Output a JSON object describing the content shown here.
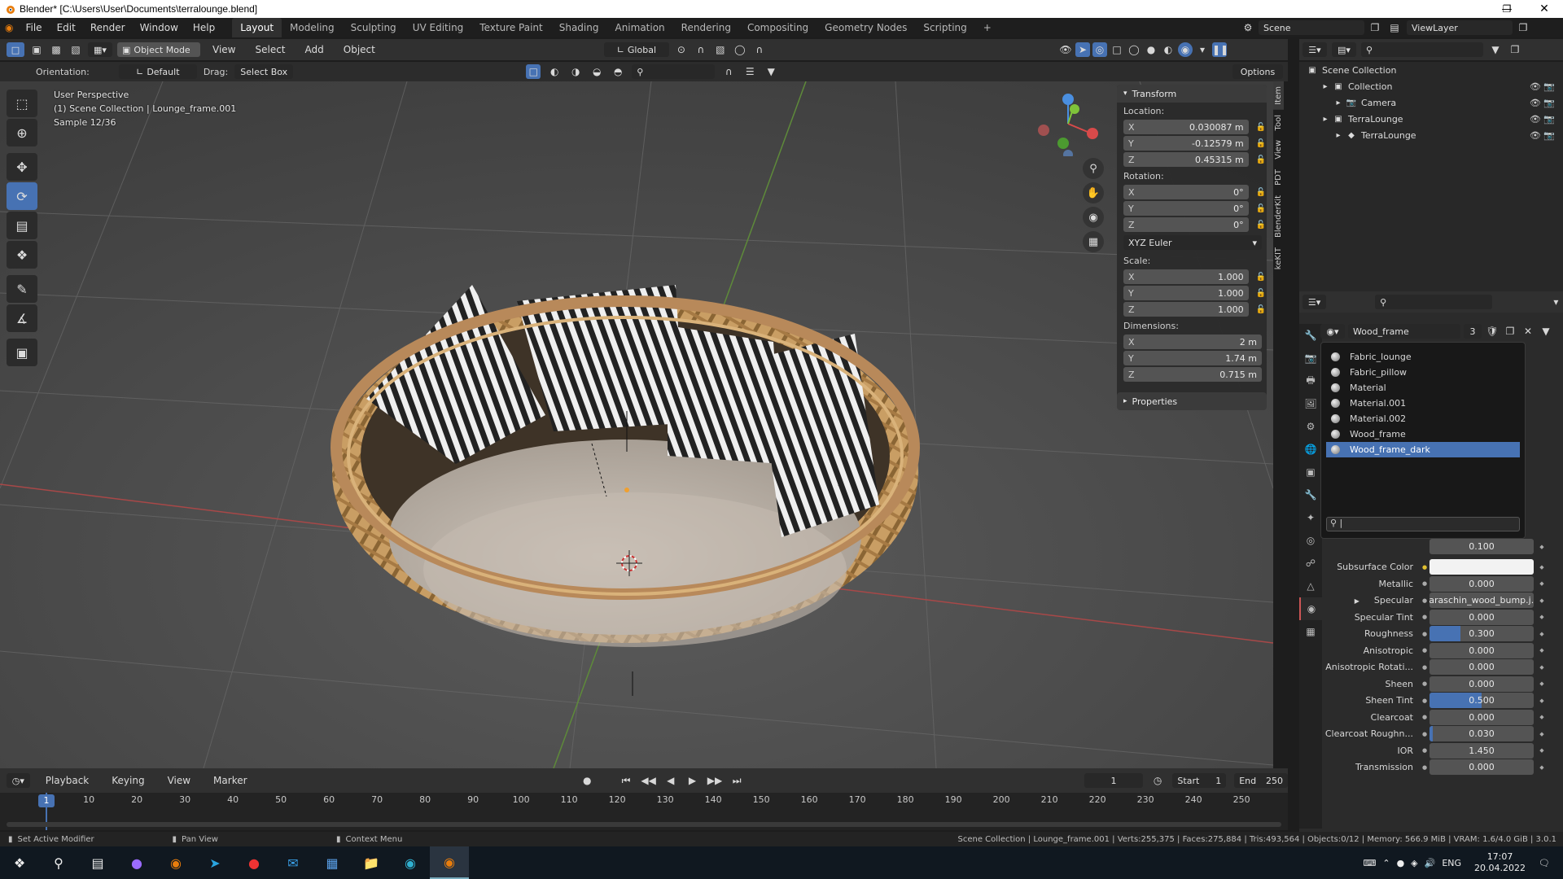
{
  "window": {
    "title": "Blender* [C:\\Users\\User\\Documents\\terralounge.blend]"
  },
  "menu": {
    "items": [
      "File",
      "Edit",
      "Render",
      "Window",
      "Help"
    ]
  },
  "workspaces": [
    "Layout",
    "Modeling",
    "Sculpting",
    "UV Editing",
    "Texture Paint",
    "Shading",
    "Animation",
    "Rendering",
    "Compositing",
    "Geometry Nodes",
    "Scripting"
  ],
  "workspace_add": "+",
  "scene": {
    "name": "Scene",
    "view_layer": "ViewLayer"
  },
  "viewport_header": {
    "mode": "Object Mode",
    "view": "View",
    "select": "Select",
    "add": "Add",
    "object": "Object",
    "transform_orientation": "Global",
    "orientation_label": "Orientation:",
    "orientation_value": "Default",
    "drag_label": "Drag:",
    "drag_value": "Select Box",
    "options": "Options"
  },
  "viewport_info": {
    "line1": "User Perspective",
    "line2": "(1) Scene Collection | Lounge_frame.001",
    "line3": "Sample 12/36"
  },
  "npanel": {
    "transform": "Transform",
    "location_label": "Location:",
    "location": [
      {
        "axis": "X",
        "value": "0.030087 m"
      },
      {
        "axis": "Y",
        "value": "-0.12579 m"
      },
      {
        "axis": "Z",
        "value": "0.45315 m"
      }
    ],
    "rotation_label": "Rotation:",
    "rotation": [
      {
        "axis": "X",
        "value": "0°"
      },
      {
        "axis": "Y",
        "value": "0°"
      },
      {
        "axis": "Z",
        "value": "0°"
      }
    ],
    "rotation_mode": "XYZ Euler",
    "scale_label": "Scale:",
    "scale": [
      {
        "axis": "X",
        "value": "1.000"
      },
      {
        "axis": "Y",
        "value": "1.000"
      },
      {
        "axis": "Z",
        "value": "1.000"
      }
    ],
    "dimensions_label": "Dimensions:",
    "dimensions": [
      {
        "axis": "X",
        "value": "2 m"
      },
      {
        "axis": "Y",
        "value": "1.74 m"
      },
      {
        "axis": "Z",
        "value": "0.715 m"
      }
    ],
    "properties": "Properties",
    "tabs": [
      "Item",
      "Tool",
      "View",
      "PDT",
      "BlenderKit",
      "keKIT"
    ]
  },
  "outliner": {
    "rows": [
      {
        "name": "Scene Collection",
        "depth": 0
      },
      {
        "name": "Collection",
        "depth": 1
      },
      {
        "name": "Camera",
        "depth": 2
      },
      {
        "name": "TerraLounge",
        "depth": 1
      },
      {
        "name": "TerraLounge",
        "depth": 2
      }
    ]
  },
  "material": {
    "name": "Wood_frame",
    "users": "3",
    "list": [
      "Fabric_lounge",
      "Fabric_pillow",
      "Material",
      "Material.001",
      "Material.002",
      "Wood_frame",
      "Wood_frame_dark"
    ],
    "selected": "Wood_frame_dark",
    "partial_value": "0.100",
    "rows": [
      {
        "label": "Subsurface Color",
        "value": "",
        "color": "#f2f2f2"
      },
      {
        "label": "Metallic",
        "value": "0.000",
        "fill": 0
      },
      {
        "label": "Specular",
        "value": "varaschin_wood_bump.j...",
        "expand": true
      },
      {
        "label": "Specular Tint",
        "value": "0.000",
        "fill": 0
      },
      {
        "label": "Roughness",
        "value": "0.300",
        "fill": 0.3
      },
      {
        "label": "Anisotropic",
        "value": "0.000",
        "fill": 0
      },
      {
        "label": "Anisotropic Rotati...",
        "value": "0.000",
        "fill": 0
      },
      {
        "label": "Sheen",
        "value": "0.000",
        "fill": 0
      },
      {
        "label": "Sheen Tint",
        "value": "0.500",
        "fill": 0.5
      },
      {
        "label": "Clearcoat",
        "value": "0.000",
        "fill": 0
      },
      {
        "label": "Clearcoat Roughn...",
        "value": "0.030",
        "fill": 0.03
      },
      {
        "label": "IOR",
        "value": "1.450",
        "fill": 0
      },
      {
        "label": "Transmission",
        "value": "0.000",
        "fill": 0
      }
    ]
  },
  "timeline": {
    "menus": [
      "Playback",
      "Keying",
      "View",
      "Marker"
    ],
    "current": "1",
    "start_label": "Start",
    "start": "1",
    "end_label": "End",
    "end": "250",
    "ticks": [
      "1",
      "10",
      "20",
      "30",
      "40",
      "50",
      "60",
      "70",
      "80",
      "90",
      "100",
      "110",
      "120",
      "130",
      "140",
      "150",
      "160",
      "170",
      "180",
      "190",
      "200",
      "210",
      "220",
      "230",
      "240",
      "250"
    ]
  },
  "status": {
    "left1": "Set Active Modifier",
    "left2": "Pan View",
    "left3": "Context Menu",
    "right": "Scene Collection | Lounge_frame.001 | Verts:255,375 | Faces:275,884 | Tris:493,564 | Objects:0/12 | Memory: 566.9 MiB | VRAM: 1.6/4.0 GiB | 3.0.1"
  },
  "taskbar": {
    "lang": "ENG",
    "time": "17:07",
    "date": "20.04.2022"
  }
}
